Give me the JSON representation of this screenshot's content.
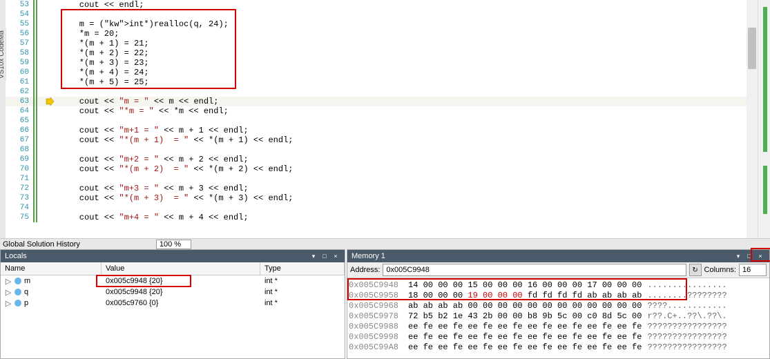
{
  "sidebar_tab": "VS10x CodeMa",
  "status_text": "Global Solution History",
  "zoom": "100 %",
  "code": {
    "lines": [
      {
        "n": 53,
        "t": "    cout << endl;"
      },
      {
        "n": 54,
        "t": ""
      },
      {
        "n": 55,
        "t": "    m = (int*)realloc(q, 24);"
      },
      {
        "n": 56,
        "t": "    *m = 20;"
      },
      {
        "n": 57,
        "t": "    *(m + 1) = 21;"
      },
      {
        "n": 58,
        "t": "    *(m + 2) = 22;"
      },
      {
        "n": 59,
        "t": "    *(m + 3) = 23;"
      },
      {
        "n": 60,
        "t": "    *(m + 4) = 24;"
      },
      {
        "n": 61,
        "t": "    *(m + 5) = 25;"
      },
      {
        "n": 62,
        "t": ""
      },
      {
        "n": 63,
        "t": "    cout << \"m = \" << m << endl;"
      },
      {
        "n": 64,
        "t": "    cout << \"*m = \" << *m << endl;"
      },
      {
        "n": 65,
        "t": ""
      },
      {
        "n": 66,
        "t": "    cout << \"m+1 = \" << m + 1 << endl;"
      },
      {
        "n": 67,
        "t": "    cout << \"*(m + 1)  = \" << *(m + 1) << endl;"
      },
      {
        "n": 68,
        "t": ""
      },
      {
        "n": 69,
        "t": "    cout << \"m+2 = \" << m + 2 << endl;"
      },
      {
        "n": 70,
        "t": "    cout << \"*(m + 2)  = \" << *(m + 2) << endl;"
      },
      {
        "n": 71,
        "t": ""
      },
      {
        "n": 72,
        "t": "    cout << \"m+3 = \" << m + 3 << endl;"
      },
      {
        "n": 73,
        "t": "    cout << \"*(m + 3)  = \" << *(m + 3) << endl;"
      },
      {
        "n": 74,
        "t": ""
      },
      {
        "n": 75,
        "t": "    cout << \"m+4 = \" << m + 4 << endl;"
      }
    ],
    "current_line": 63
  },
  "locals": {
    "title": "Locals",
    "columns": {
      "name": "Name",
      "value": "Value",
      "type": "Type"
    },
    "rows": [
      {
        "name": "m",
        "value": "0x005c9948 {20}",
        "type": "int *"
      },
      {
        "name": "q",
        "value": "0x005c9948 {20}",
        "type": "int *"
      },
      {
        "name": "p",
        "value": "0x005c9760 {0}",
        "type": "int *"
      }
    ]
  },
  "memory": {
    "title": "Memory 1",
    "address_label": "Address:",
    "address_value": "0x005C9948",
    "columns_label": "Columns:",
    "columns_value": "16",
    "rows": [
      {
        "addr": "0x005C9948",
        "hex": "14 00 00 00 15 00 00 00 16 00 00 00 17 00 00 00",
        "ascii": "................"
      },
      {
        "addr": "0x005C9958",
        "hex": "18 00 00 00 ",
        "hex_red": "19 00 00 00",
        "hex2": " fd fd fd fd ab ab ab ab",
        "ascii": "........????????"
      },
      {
        "addr": "0x005C9968",
        "hex": "ab ab ab ab 00 00 00 00 00 00 00 00 00 00 00 00",
        "ascii": "????............"
      },
      {
        "addr": "0x005C9978",
        "hex": "72 b5 b2 1e 43 2b 00 00 b8 9b 5c 00 c0 8d 5c 00",
        "ascii": "r??.C+..??\\.??\\."
      },
      {
        "addr": "0x005C9988",
        "hex": "ee fe ee fe ee fe ee fe ee fe ee fe ee fe ee fe",
        "ascii": "????????????????"
      },
      {
        "addr": "0x005C9998",
        "hex": "ee fe ee fe ee fe ee fe ee fe ee fe ee fe ee fe",
        "ascii": "????????????????"
      },
      {
        "addr": "0x005C99A8",
        "hex": "ee fe ee fe ee fe ee fe ee fe ee fe ee fe ee fe",
        "ascii": "????????????????"
      }
    ]
  }
}
